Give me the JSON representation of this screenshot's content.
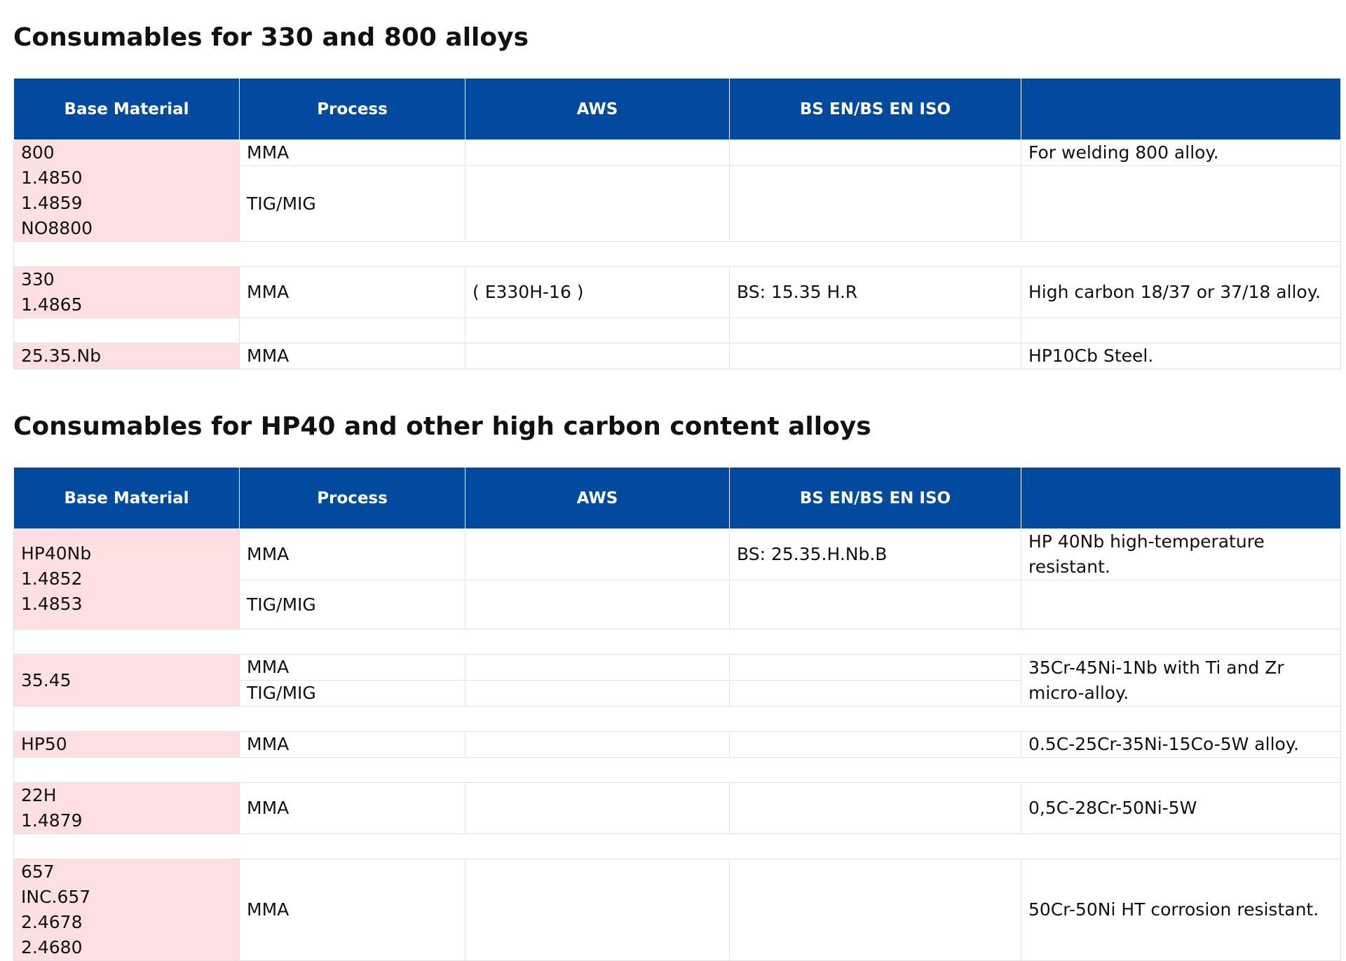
{
  "sections": [
    {
      "title": "Consumables for 330 and 800 alloys",
      "headers": [
        "Base Material",
        "Process",
        "AWS",
        "BS EN/BS EN ISO",
        ""
      ],
      "rows": {
        "r800_base": [
          "800",
          "1.4850",
          "1.4859",
          "NO8800"
        ],
        "r800_mma": {
          "process": "MMA",
          "aws": "",
          "bs": "",
          "note": "For welding 800 alloy."
        },
        "r800_tig": {
          "process": "TIG/MIG",
          "aws": "",
          "bs": "",
          "note": ""
        },
        "r330_base": [
          "330",
          "1.4865"
        ],
        "r330_mma": {
          "process": "MMA",
          "aws": "( E330H-16 )",
          "bs": "BS: 15.35 H.R",
          "note": "High carbon 18/37 or 37/18 alloy."
        },
        "r2535_base": [
          "25.35.Nb"
        ],
        "r2535_mma": {
          "process": "MMA",
          "aws": "",
          "bs": "",
          "note": "HP10Cb Steel."
        }
      }
    },
    {
      "title": "Consumables for HP40 and other high carbon content alloys",
      "headers": [
        "Base Material",
        "Process",
        "AWS",
        "BS EN/BS EN ISO",
        ""
      ],
      "rows": {
        "hp40_base": [
          "HP40Nb",
          "1.4852",
          "1.4853"
        ],
        "hp40_mma": {
          "process": "MMA",
          "aws": "",
          "bs": "BS: 25.35.H.Nb.B",
          "note": "HP 40Nb high-temperature resistant."
        },
        "hp40_tig": {
          "process": "TIG/MIG",
          "aws": "",
          "bs": "",
          "note": ""
        },
        "r3545_base": [
          "35.45"
        ],
        "r3545_mma": {
          "process": "MMA",
          "aws": "",
          "bs": ""
        },
        "r3545_tig": {
          "process": "TIG/MIG",
          "aws": "",
          "bs": ""
        },
        "r3545_note": [
          "35Cr-45Ni-1Nb with Ti and Zr",
          "micro-alloy."
        ],
        "hp50_base": [
          "HP50"
        ],
        "hp50_mma": {
          "process": "MMA",
          "aws": "",
          "bs": "",
          "note": "0.5C-25Cr-35Ni-15Co-5W alloy."
        },
        "r22h_base": [
          "22H",
          "1.4879"
        ],
        "r22h_mma": {
          "process": "MMA",
          "aws": "",
          "bs": "",
          "note": "0,5C-28Cr-50Ni-5W"
        },
        "r657_base": [
          "657",
          "INC.657",
          "2.4678",
          "2.4680"
        ],
        "r657_mma": {
          "process": "MMA",
          "aws": "",
          "bs": "",
          "note": "50Cr-50Ni HT corrosion resistant."
        }
      }
    }
  ]
}
